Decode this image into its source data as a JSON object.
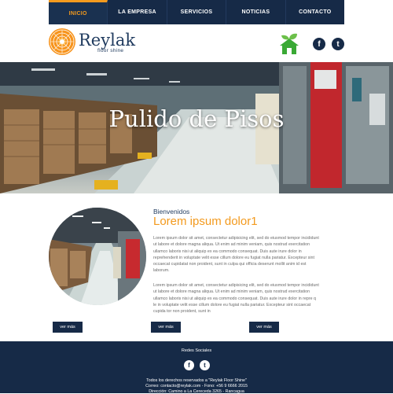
{
  "nav": {
    "items": [
      {
        "label": "INICIO"
      },
      {
        "label": "LA EMPRESA"
      },
      {
        "label": "SERVICIOS"
      },
      {
        "label": "NOTICIAS"
      },
      {
        "label": "CONTACTO"
      }
    ],
    "active_index": 0
  },
  "brand": {
    "name": "Reylak",
    "tagline": "floor shine"
  },
  "header_icons": {
    "eco": "eco-house-leaf-icon",
    "facebook": "f",
    "twitter": "t"
  },
  "hero": {
    "title": "Pulido de Pisos"
  },
  "content": {
    "welcome": "Bienvenidos",
    "headline": "Lorem ipsum dolor1",
    "paragraph1": "Lorem ipsum dolor sit amet, consectetur adipisicing elit, sed do eiusmod tempor incididunt ut labore et dolore magna aliqua. Ut enim ad minim veniam, quis nostrud exercitation ullamco laboris nisi ut aliquip ex ea commodo consequat. Duis aute irure dolor in reprehenderit in voluptate velit esse cillum dolore eu fugiat nulla pariatur. Excepteur sint occaecat cupidatat non proident, sunt in culpa qui officia deserunt mollit anim id est laborum.",
    "paragraph2": "Lorem ipsum dolor sit amet, consectetur adipisicing elit, sed do eiusmod tempor incididunt ut labore et dolore magna aliqua. Ut enim ad minim veniam, quis nostrud exercitation ullamco laboris nisi ut aliquip ex ea commodo consequat. Duis aute irure dolor in repre q le in voluptate velit esse cillum dolore eu fugiat nulla pariatur. Excepteur sint occaecat cupida tor non proident, sunt in",
    "buttons": [
      {
        "label": "ver más"
      },
      {
        "label": "ver más"
      },
      {
        "label": "ver más"
      }
    ]
  },
  "footer": {
    "title": "Redes Sociales",
    "facebook": "f",
    "twitter": "t",
    "line1": "Todos los derechos reservados a \"Reylak Floor Shine\"",
    "line2": "Correo: contacto@reylak.com - Fono: +56 9 6666 2015",
    "line3": "Dirección: Camino a La Cereceda 3265 - Rancagua"
  },
  "colors": {
    "navy": "#162a47",
    "accent": "#f39a1e",
    "brand_text": "#1f3a5e",
    "eco_green": "#3aa935"
  }
}
